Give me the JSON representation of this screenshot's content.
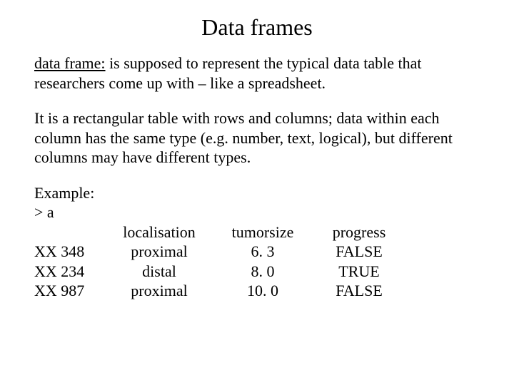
{
  "title": "Data frames",
  "term": "data frame:",
  "def_rest": " is supposed to represent the typical data table that researchers come up with – like a spreadsheet.",
  "para2": "It is a rectangular table with rows and columns; data within each column has the same type (e.g. number, text, logical), but different columns may have different types.",
  "example_label": "Example:",
  "prompt": "> a",
  "headers": {
    "h0": "",
    "h1": "localisation",
    "h2": "tumorsize",
    "h3": "progress"
  },
  "rows": [
    {
      "id": "XX 348",
      "localisation": "proximal",
      "tumorsize": "6. 3",
      "progress": "FALSE"
    },
    {
      "id": "XX 234",
      "localisation": "distal",
      "tumorsize": "8. 0",
      "progress": "TRUE"
    },
    {
      "id": "XX 987",
      "localisation": "proximal",
      "tumorsize": "10. 0",
      "progress": "FALSE"
    }
  ]
}
